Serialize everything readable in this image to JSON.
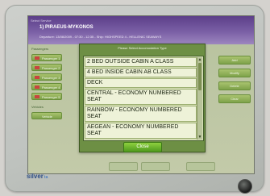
{
  "app": {
    "small_title": "Select Service",
    "route": "1) PIRAEUS-MYKONOS",
    "route_info": "Departure: 13/08/2009 - 07:30 - 12:35 - Ship: HIGHSPEED 4 - HELLENIC SEAWAYS"
  },
  "sidebar": {
    "label_top": "Passengers",
    "label_mid": "Vehicles",
    "buttons": [
      "Passenger 1",
      "Passenger 2",
      "Passenger 3",
      "Passenger 4",
      "Passenger 5"
    ],
    "vehicle_button": "Vehicle"
  },
  "right_panel": {
    "buttons": [
      "Add",
      "Modify",
      "Delete",
      "Clear"
    ]
  },
  "modal": {
    "title": "Please Select Accomodation Type",
    "items": [
      "2 BED OUTSIDE CABIN A CLASS",
      "4 BED INSIDE CABIN AB CLASS",
      "DECK",
      "CENTRAL - ECONOMY NUMBERED SEAT",
      "RAINBOW - ECONOMY NUMBERED SEAT",
      "AEGEAN - ECONOMY NUMBERED SEAT"
    ],
    "close_label": "Close"
  },
  "brand": {
    "logo": "silver",
    "logo_sub": "ta"
  },
  "colors": {
    "header": "#6a4c98",
    "modal": "#6d8f44",
    "list_bg": "#eef2d8",
    "close_button": "#6bb52e"
  }
}
